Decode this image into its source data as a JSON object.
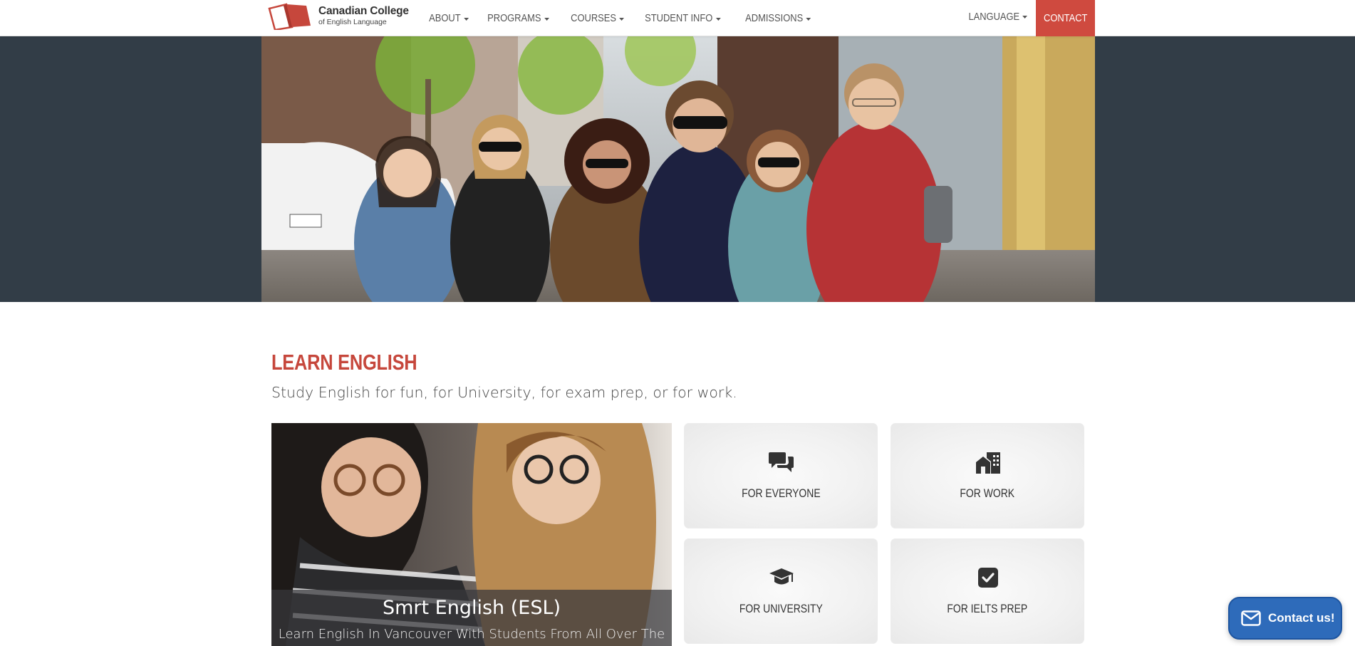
{
  "brand": {
    "title": "Canadian College",
    "subtitle": "of English Language",
    "colors": {
      "accent": "#cf4a3f",
      "dark_band": "#323d47",
      "float_button": "#2e6bba"
    }
  },
  "nav": {
    "items": [
      {
        "label": "ABOUT"
      },
      {
        "label": "PROGRAMS"
      },
      {
        "label": "COURSES"
      },
      {
        "label": "STUDENT INFO"
      },
      {
        "label": "ADMISSIONS"
      }
    ],
    "language_label": "LANGUAGE",
    "contact_label": "CONTACT"
  },
  "learn": {
    "title": "LEARN ENGLISH",
    "subtitle": "Study English for fun, for University, for exam prep, or for work."
  },
  "feature": {
    "title": "Smrt English (ESL)",
    "description": "Learn English In Vancouver With Students From All Over The"
  },
  "tiles": [
    {
      "label": "FOR EVERYONE",
      "icon": "chat-bubbles-icon"
    },
    {
      "label": "FOR WORK",
      "icon": "city-buildings-icon"
    },
    {
      "label": "FOR UNIVERSITY",
      "icon": "graduation-cap-icon"
    },
    {
      "label": "FOR IELTS PREP",
      "icon": "check-square-icon"
    }
  ],
  "contact_float": {
    "label": "Contact us!",
    "icon": "envelope-icon"
  }
}
